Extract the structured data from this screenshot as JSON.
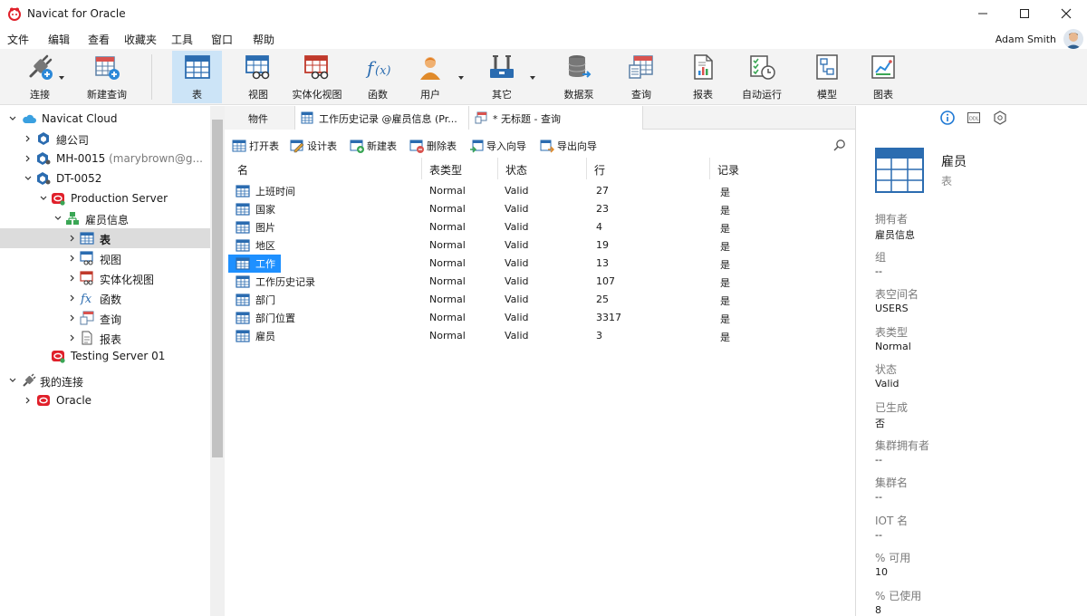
{
  "window": {
    "title": "Navicat for Oracle"
  },
  "menu": [
    "文件",
    "编辑",
    "查看",
    "收藏夹",
    "工具",
    "窗口",
    "帮助"
  ],
  "user": {
    "name": "Adam Smith"
  },
  "toolbar": [
    {
      "label": "连接",
      "icon": "plug-icon"
    },
    {
      "label": "新建查询",
      "icon": "new-query-icon"
    },
    {
      "label": "表",
      "icon": "table-icon"
    },
    {
      "label": "视图",
      "icon": "view-icon"
    },
    {
      "label": "实体化视图",
      "icon": "materialized-view-icon"
    },
    {
      "label": "函数",
      "icon": "function-icon"
    },
    {
      "label": "用户",
      "icon": "user-icon"
    },
    {
      "label": "其它",
      "icon": "tools-icon"
    },
    {
      "label": "数据泵",
      "icon": "data-pump-icon"
    },
    {
      "label": "查询",
      "icon": "query-icon"
    },
    {
      "label": "报表",
      "icon": "report-icon"
    },
    {
      "label": "自动运行",
      "icon": "automation-icon"
    },
    {
      "label": "模型",
      "icon": "model-icon"
    },
    {
      "label": "图表",
      "icon": "chart-icon"
    }
  ],
  "tree": {
    "navicat_cloud": "Navicat Cloud",
    "company": "總公司",
    "mh_name": "MH-0015",
    "mh_owner": "(marybrown@g...",
    "dt_name": "DT-0052",
    "production_server": "Production Server",
    "schema": "雇员信息",
    "tables": "表",
    "views": "视图",
    "mviews": "实体化视图",
    "functions": "函数",
    "queries": "查询",
    "reports": "报表",
    "testing_server": "Testing Server 01",
    "my_connections": "我的连接",
    "oracle": "Oracle"
  },
  "tabs": {
    "objects": "物件",
    "history": "工作历史记录 @雇员信息 (Pr...",
    "untitled": "* 无标题 - 查询"
  },
  "object_toolbar": [
    "打开表",
    "设计表",
    "新建表",
    "删除表",
    "导入向导",
    "导出向导"
  ],
  "columns": [
    "名",
    "表类型",
    "状态",
    "行",
    "记录"
  ],
  "rows": [
    {
      "name": "上班时间",
      "type": "Normal",
      "status": "Valid",
      "rows": "27",
      "logging": "是"
    },
    {
      "name": "国家",
      "type": "Normal",
      "status": "Valid",
      "rows": "23",
      "logging": "是"
    },
    {
      "name": "图片",
      "type": "Normal",
      "status": "Valid",
      "rows": "4",
      "logging": "是"
    },
    {
      "name": "地区",
      "type": "Normal",
      "status": "Valid",
      "rows": "19",
      "logging": "是"
    },
    {
      "name": "工作",
      "type": "Normal",
      "status": "Valid",
      "rows": "13",
      "logging": "是"
    },
    {
      "name": "工作历史记录",
      "type": "Normal",
      "status": "Valid",
      "rows": "107",
      "logging": "是"
    },
    {
      "name": "部门",
      "type": "Normal",
      "status": "Valid",
      "rows": "25",
      "logging": "是"
    },
    {
      "name": "部门位置",
      "type": "Normal",
      "status": "Valid",
      "rows": "3317",
      "logging": "是"
    },
    {
      "name": "雇员",
      "type": "Normal",
      "status": "Valid",
      "rows": "3",
      "logging": "是"
    }
  ],
  "selected_row": 4,
  "info": {
    "title": "雇员",
    "subtitle": "表",
    "props": [
      {
        "label": "拥有者",
        "value": "雇员信息"
      },
      {
        "label": "组",
        "value": "--"
      },
      {
        "label": "表空间名",
        "value": "USERS"
      },
      {
        "label": "表类型",
        "value": "Normal"
      },
      {
        "label": "状态",
        "value": "Valid"
      },
      {
        "label": "已生成",
        "value": "否"
      },
      {
        "label": "集群拥有者",
        "value": "--"
      },
      {
        "label": "集群名",
        "value": "--"
      },
      {
        "label": "IOT 名",
        "value": "--"
      },
      {
        "label": "% 可用",
        "value": "10"
      },
      {
        "label": "% 已使用",
        "value": "8"
      }
    ]
  },
  "colors": {
    "accent": "#1e90ff",
    "brand_red": "#e0202a",
    "toolbar_bg": "#f3f3f3"
  }
}
